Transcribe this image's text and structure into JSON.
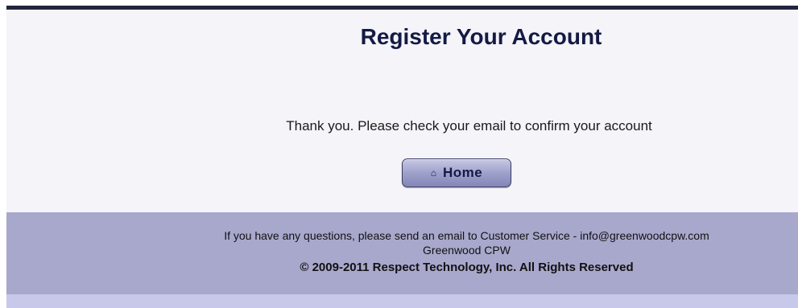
{
  "header": {
    "title": "Register Your Account"
  },
  "main": {
    "message": "Thank you. Please check your email to confirm your account",
    "home_button": {
      "icon": "home-icon",
      "icon_glyph": "⌂",
      "label": "Home"
    }
  },
  "footer": {
    "contact": "If you have any questions, please send an email to Customer Service - info@greenwoodcpw.com",
    "company": "Greenwood CPW",
    "copyright": "© 2009-2011 Respect Technology, Inc. All Rights Reserved"
  },
  "colors": {
    "top_bar": "#23253f",
    "content_bg": "#f4f4f9",
    "footer_bg": "#a8a8cd",
    "bottom_bar": "#c8c8ea",
    "title_text": "#141a43"
  }
}
